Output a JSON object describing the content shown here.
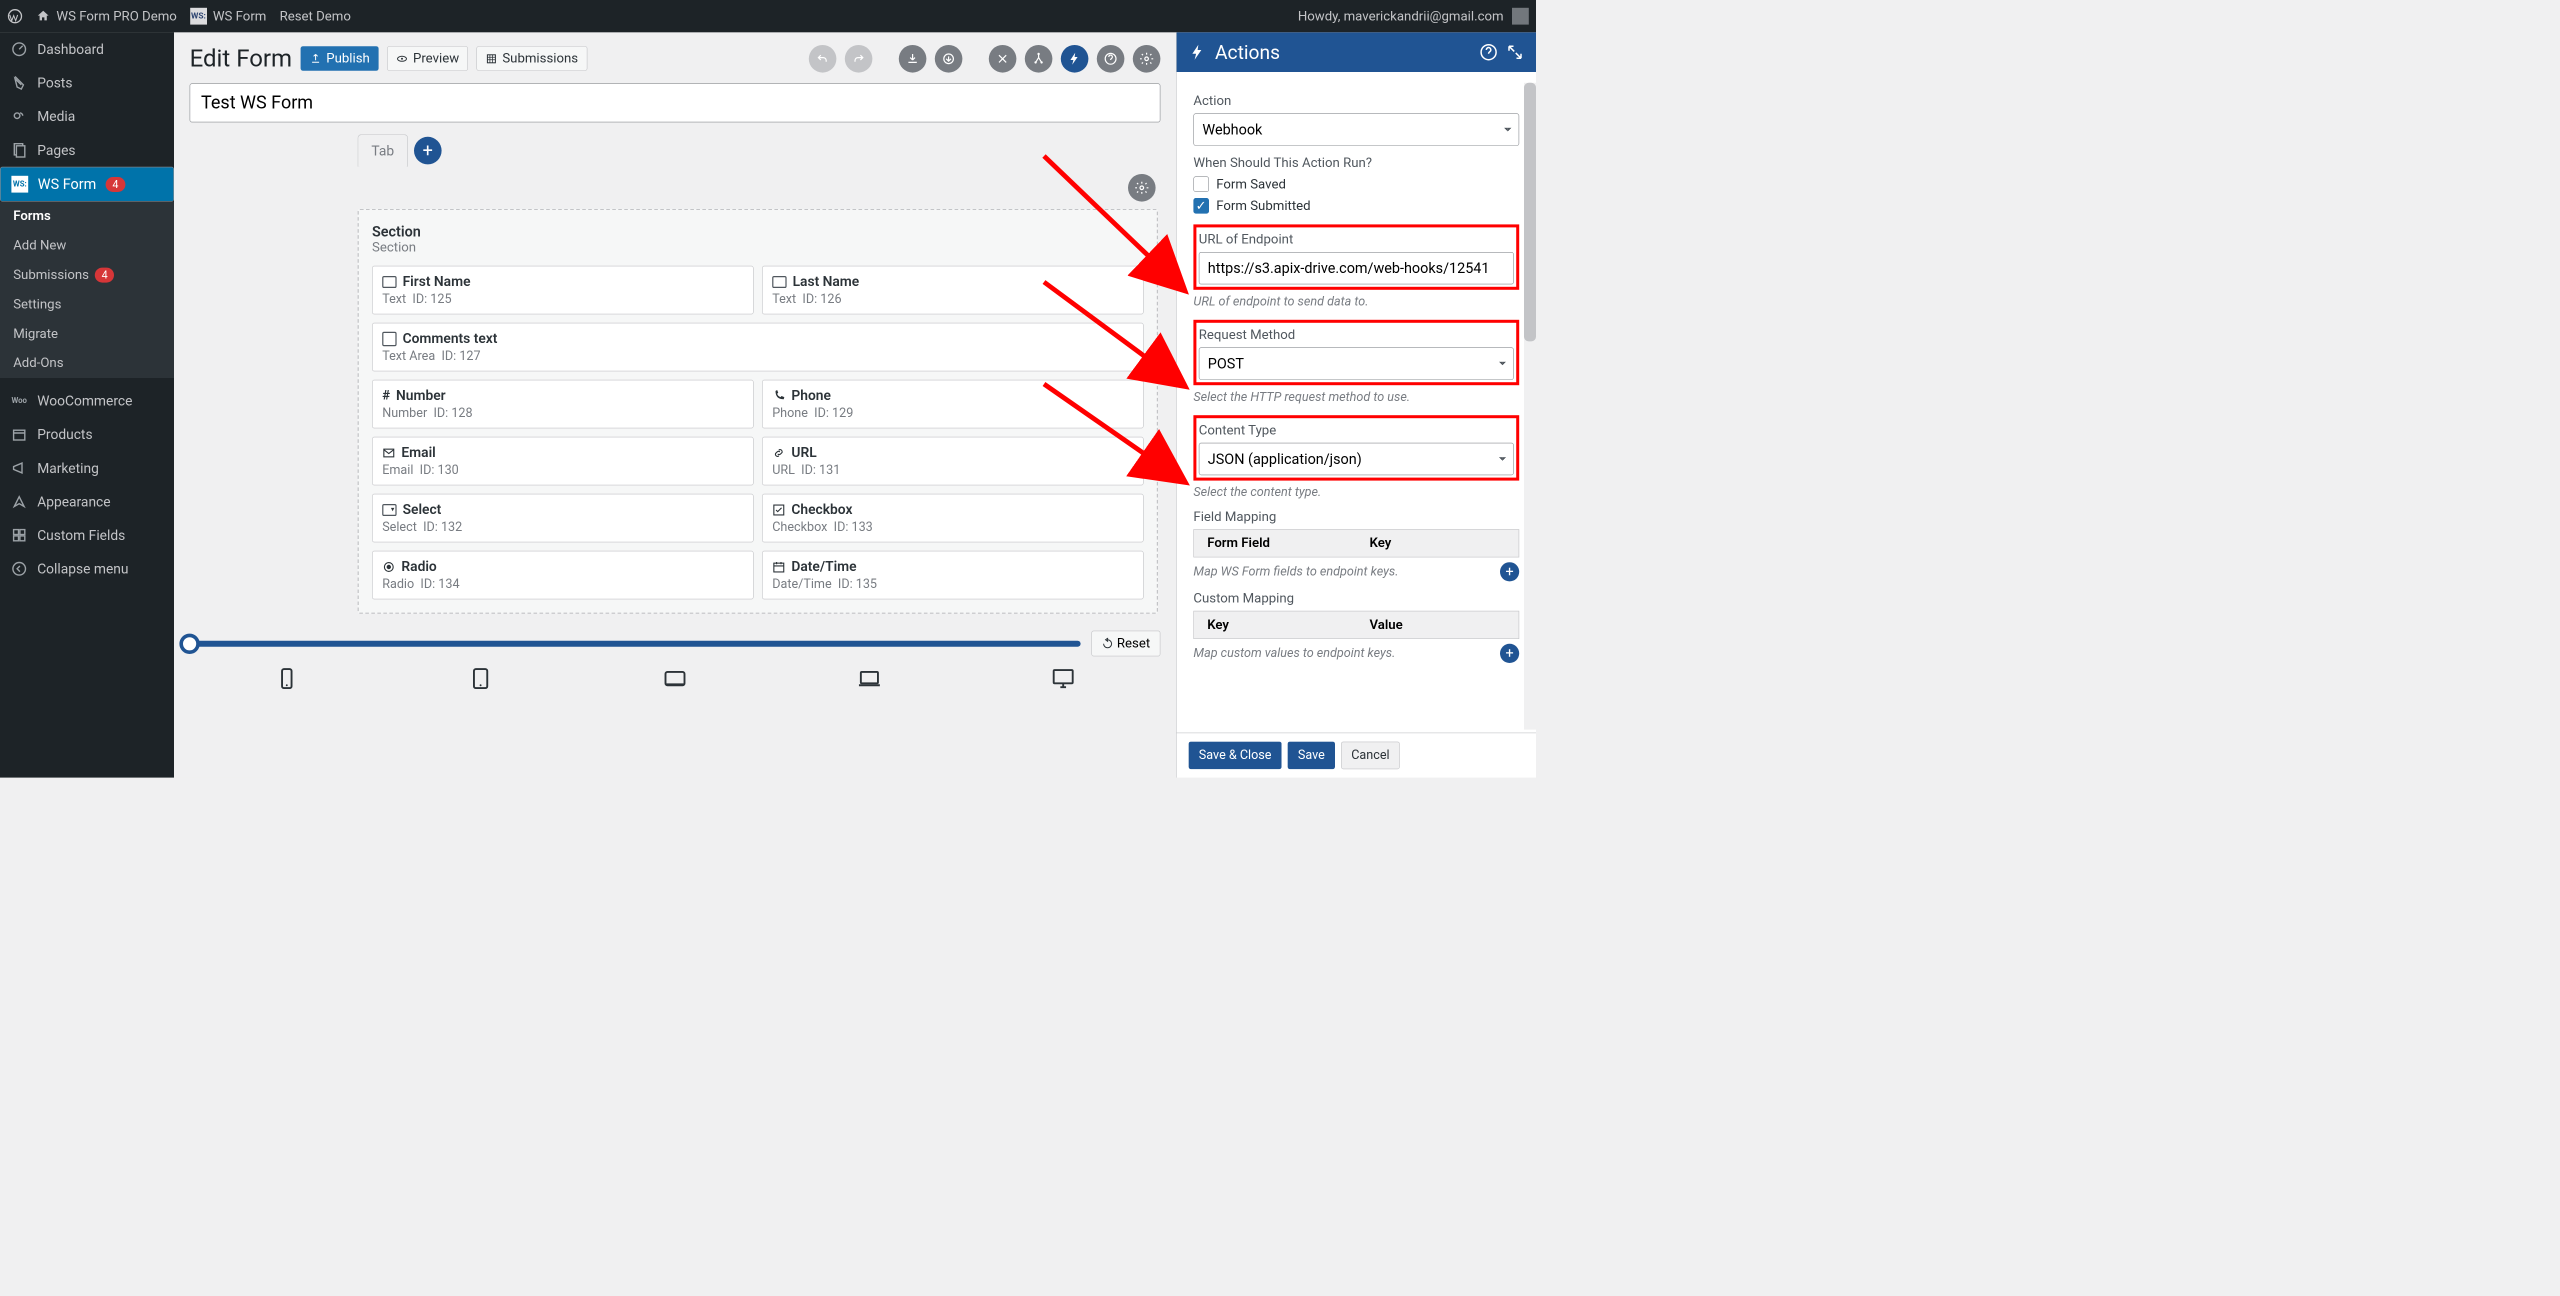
{
  "wpbar": {
    "site": "WS Form PRO Demo",
    "wsform": "WS Form",
    "reset": "Reset Demo",
    "howdy": "Howdy, maverickandrii@gmail.com"
  },
  "menu": {
    "dashboard": "Dashboard",
    "posts": "Posts",
    "media": "Media",
    "pages": "Pages",
    "wsform": "WS Form",
    "wsform_badge": "4",
    "sub": {
      "forms": "Forms",
      "addnew": "Add New",
      "submissions": "Submissions",
      "submissions_badge": "4",
      "settings": "Settings",
      "migrate": "Migrate",
      "addons": "Add-Ons"
    },
    "woocommerce": "WooCommerce",
    "products": "Products",
    "marketing": "Marketing",
    "appearance": "Appearance",
    "customfields": "Custom Fields",
    "collapse": "Collapse menu"
  },
  "page": {
    "title": "Edit Form",
    "publish": "Publish",
    "preview": "Preview",
    "submissions": "Submissions",
    "form_name": "Test WS Form",
    "tab": "Tab",
    "reset": "Reset"
  },
  "section": {
    "title": "Section",
    "sub": "Section",
    "fields": [
      {
        "label": "First Name",
        "type": "Text",
        "id": "125",
        "full": false,
        "icon": "text"
      },
      {
        "label": "Last Name",
        "type": "Text",
        "id": "126",
        "full": false,
        "icon": "text"
      },
      {
        "label": "Comments text",
        "type": "Text Area",
        "id": "127",
        "full": true,
        "icon": "textarea"
      },
      {
        "label": "Number",
        "type": "Number",
        "id": "128",
        "full": false,
        "icon": "hash"
      },
      {
        "label": "Phone",
        "type": "Phone",
        "id": "129",
        "full": false,
        "icon": "phone"
      },
      {
        "label": "Email",
        "type": "Email",
        "id": "130",
        "full": false,
        "icon": "mail"
      },
      {
        "label": "URL",
        "type": "URL",
        "id": "131",
        "full": false,
        "icon": "link"
      },
      {
        "label": "Select",
        "type": "Select",
        "id": "132",
        "full": false,
        "icon": "select"
      },
      {
        "label": "Checkbox",
        "type": "Checkbox",
        "id": "133",
        "full": false,
        "icon": "check"
      },
      {
        "label": "Radio",
        "type": "Radio",
        "id": "134",
        "full": false,
        "icon": "radio"
      },
      {
        "label": "Date/Time",
        "type": "Date/Time",
        "id": "135",
        "full": false,
        "icon": "date"
      }
    ]
  },
  "actions": {
    "title": "Actions",
    "action_lbl": "Action",
    "action_val": "Webhook",
    "when_lbl": "When Should This Action Run?",
    "opt_saved": "Form Saved",
    "opt_submitted": "Form Submitted",
    "url_lbl": "URL of Endpoint",
    "url_val": "https://s3.apix-drive.com/web-hooks/12541",
    "url_hint": "URL of endpoint to send data to.",
    "method_lbl": "Request Method",
    "method_val": "POST",
    "method_hint": "Select the HTTP request method to use.",
    "ctype_lbl": "Content Type",
    "ctype_val": "JSON (application/json)",
    "ctype_hint": "Select the content type.",
    "fieldmap_lbl": "Field Mapping",
    "fm_col1": "Form Field",
    "fm_col2": "Key",
    "fm_hint": "Map WS Form fields to endpoint keys.",
    "custommap_lbl": "Custom Mapping",
    "cm_col1": "Key",
    "cm_col2": "Value",
    "cm_hint": "Map custom values to endpoint keys.",
    "saveclose": "Save & Close",
    "save": "Save",
    "cancel": "Cancel"
  }
}
